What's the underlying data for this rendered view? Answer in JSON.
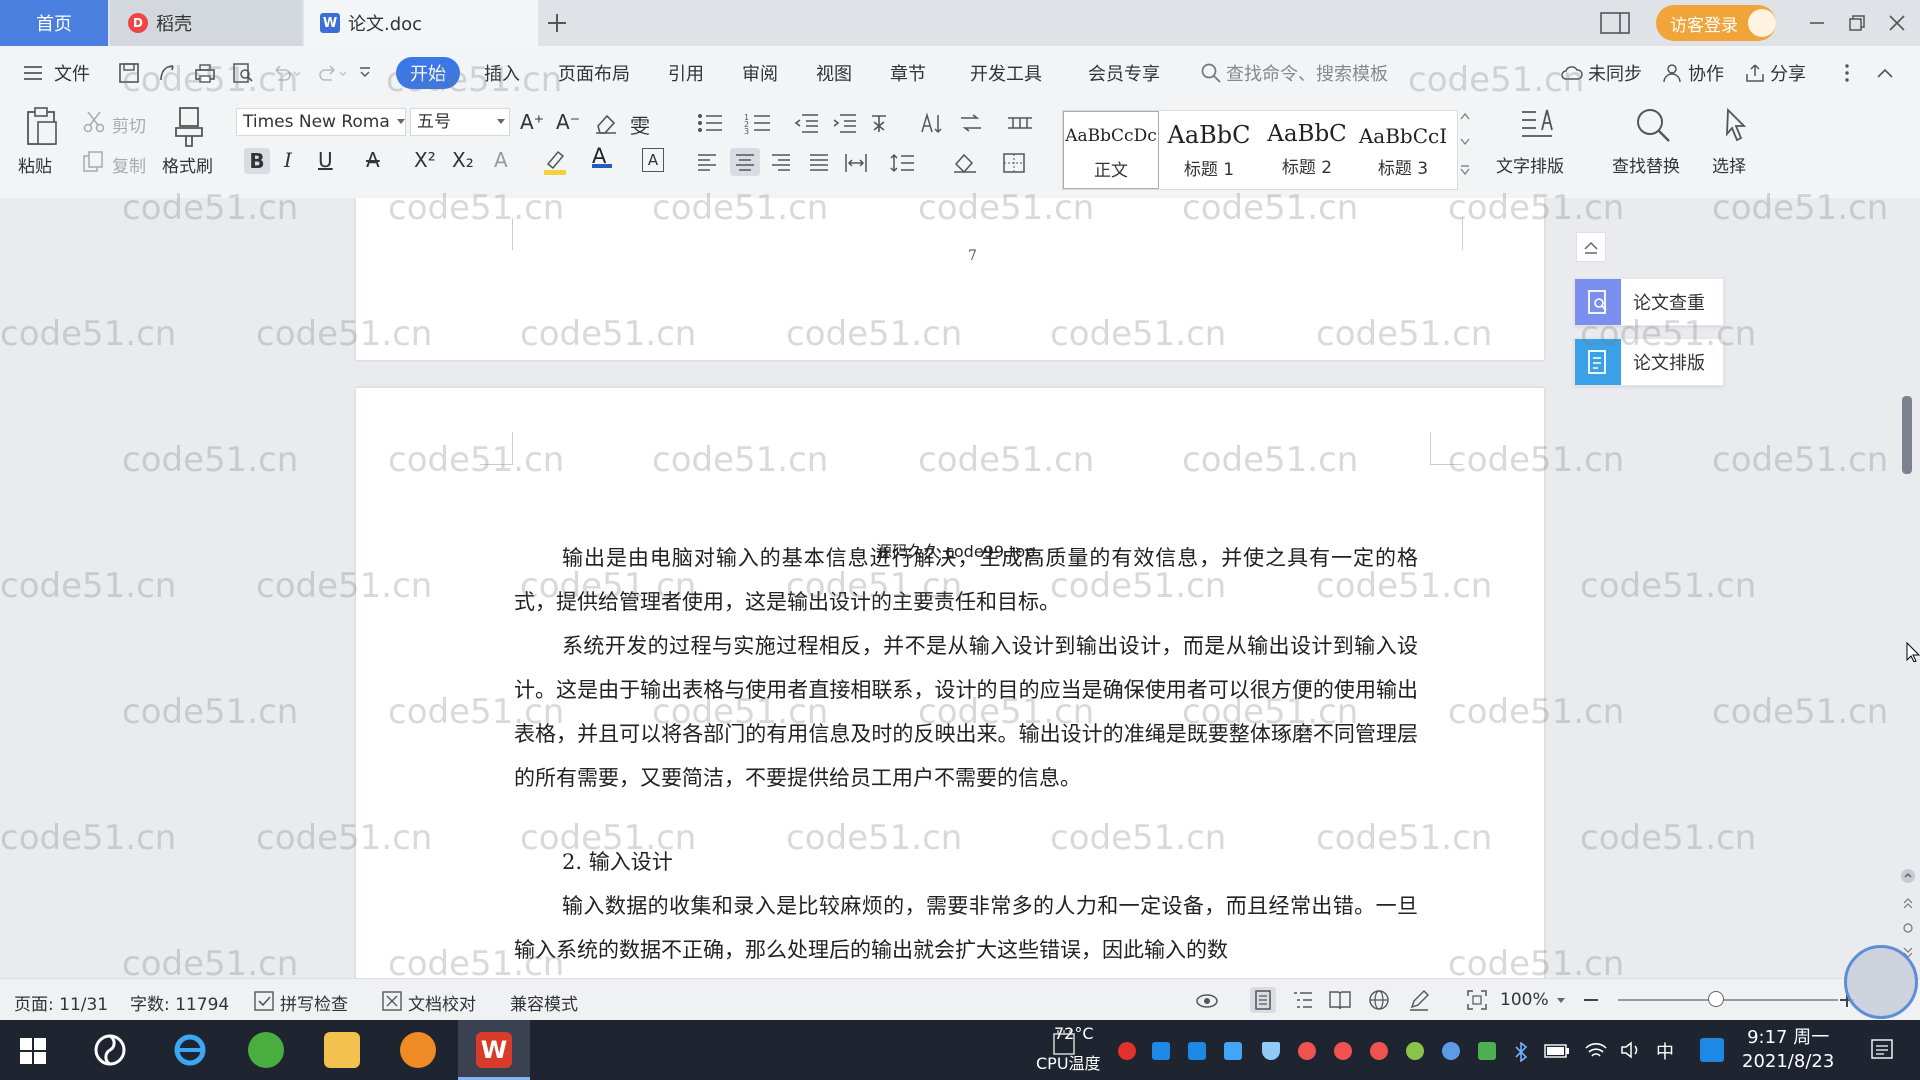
{
  "tabs": {
    "home": "首页",
    "daoke": "稻壳",
    "doc": "论文.doc"
  },
  "window": {
    "visitor_login": "访客登录"
  },
  "menu": {
    "file": "文件",
    "items": [
      "开始",
      "插入",
      "页面布局",
      "引用",
      "审阅",
      "视图",
      "章节",
      "开发工具",
      "会员专享"
    ],
    "search_placeholder": "查找命令、搜索模板",
    "unsynced": "未同步",
    "collab": "协作",
    "share": "分享"
  },
  "ribbon": {
    "paste": "粘贴",
    "cut": "剪切",
    "copy": "复制",
    "format_painter": "格式刷",
    "font_name": "Times New Roma",
    "font_size": "五号",
    "styles": [
      {
        "sample": "AaBbCcDc",
        "name": "正文"
      },
      {
        "sample": "AaBbC",
        "name": "标题 1"
      },
      {
        "sample": "AaBbC",
        "name": "标题 2"
      },
      {
        "sample": "AaBbCcI",
        "name": "标题 3"
      }
    ],
    "text_layout": "文字排版",
    "find_replace": "查找替换",
    "select": "选择"
  },
  "document": {
    "page_number": "7",
    "header_note": "源码久久 code99.top",
    "paragraphs": [
      "输出是由电脑对输入的基本信息进行解决，生成高质量的有效信息，并使之具有一定的格式，提供给管理者使用，这是输出设计的主要责任和目标。",
      "系统开发的过程与实施过程相反，并不是从输入设计到输出设计，而是从输出设计到输入设计。这是由于输出表格与使用者直接相联系，设计的目的应当是确保使用者可以很方便的使用输出表格，并且可以将各部门的有用信息及时的反映出来。输出设计的准绳是既要整体琢磨不同管理层的所有需要，又要简洁，不要提供给员工用户不需要的信息。",
      "2. 输入设计",
      "输入数据的收集和录入是比较麻烦的，需要非常多的人力和一定设备，而且经常出错。一旦输入系统的数据不正确，那么处理后的输出就会扩大这些错误，因此输入的数"
    ],
    "watermark": "code51.cn"
  },
  "side_panel": {
    "check": "论文查重",
    "format": "论文排版"
  },
  "status": {
    "page": "页面: 11/31",
    "words": "字数: 11794",
    "spell": "拼写检查",
    "proof": "文档校对",
    "compat": "兼容模式",
    "zoom": "100%"
  },
  "taskbar": {
    "cpu_temp": "72°C",
    "cpu_label": "CPU温度",
    "ime": "中",
    "time": "9:17 周一",
    "date": "2021/8/23"
  },
  "colors": {
    "accent": "#3b78e7",
    "home_tab": "#4a7fe0",
    "visitor": "#f0a43a",
    "taskbar": "#1f2530"
  }
}
